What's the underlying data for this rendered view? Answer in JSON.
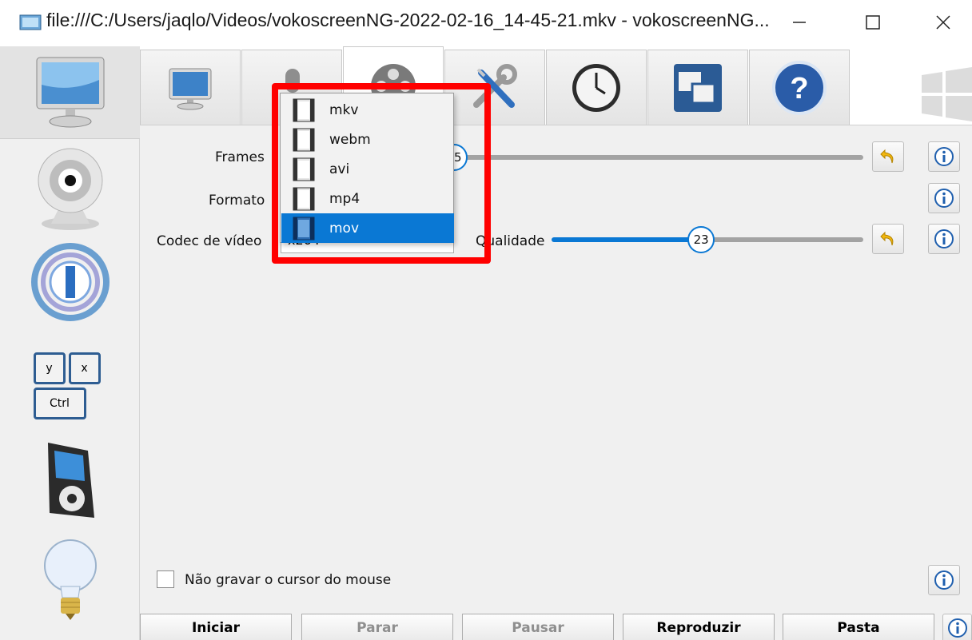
{
  "window": {
    "title": "file:///C:/Users/jaqlo/Videos/vokoscreenNG-2022-02-16_14-45-21.mkv - vokoscreenNG...",
    "controls": [
      "minimize-icon",
      "maximize-icon",
      "close-icon"
    ]
  },
  "sidebar": {
    "items": [
      {
        "name": "screen-icon"
      },
      {
        "name": "webcam-icon"
      },
      {
        "name": "magnifier-icon"
      },
      {
        "name": "showkey-icon",
        "keys": [
          "y",
          "x",
          "Ctrl"
        ]
      },
      {
        "name": "player-icon"
      },
      {
        "name": "lightbulb-icon"
      }
    ]
  },
  "tabs": [
    {
      "name": "monitor-tab-icon"
    },
    {
      "name": "microphone-tab-icon"
    },
    {
      "name": "film-reel-tab-icon"
    },
    {
      "name": "tools-tab-icon"
    },
    {
      "name": "clock-tab-icon"
    },
    {
      "name": "windows-tab-icon"
    },
    {
      "name": "help-tab-icon"
    }
  ],
  "settings": {
    "frames_label": "Frames",
    "frames_value": "25",
    "format_label": "Formato",
    "codec_label": "Codec de vídeo",
    "codec_value": "x264",
    "quality_label": "Qualidade",
    "quality_value": "23",
    "quality_fraction": 0.48,
    "no_cursor_label": "Não gravar o cursor do mouse"
  },
  "dropdown": {
    "options": [
      "mkv",
      "webm",
      "avi",
      "mp4",
      "mov"
    ],
    "selected": "mov"
  },
  "buttons": {
    "start": "Iniciar",
    "stop": "Parar",
    "pause": "Pausar",
    "play": "Reproduzir",
    "folder": "Pasta"
  },
  "colors": {
    "accent": "#0a78d4",
    "highlight": "#ff0000"
  }
}
